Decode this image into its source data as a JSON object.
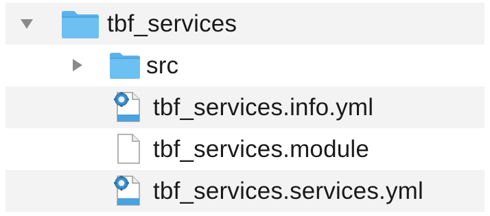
{
  "file_tree": {
    "root": {
      "name": "tbf_services",
      "expanded": true,
      "icon": "folder-icon",
      "children": [
        {
          "name": "src",
          "type": "folder",
          "expanded": false,
          "icon": "folder-icon"
        },
        {
          "name": "tbf_services.info.yml",
          "type": "file",
          "icon": "yml-file-icon"
        },
        {
          "name": "tbf_services.module",
          "type": "file",
          "icon": "blank-file-icon"
        },
        {
          "name": "tbf_services.services.yml",
          "type": "file",
          "icon": "yml-file-icon"
        }
      ]
    }
  },
  "colors": {
    "folder": "#5ab2ec",
    "stripe": "#f3f3f3",
    "disclosure": "#8a8a8a",
    "text": "#1a1a1a"
  }
}
